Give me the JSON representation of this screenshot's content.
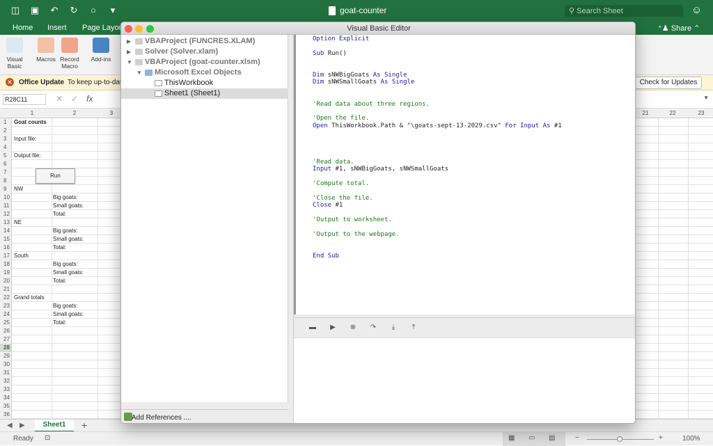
{
  "excel": {
    "doc_title": "goat-counter",
    "search_placeholder": "Search Sheet",
    "tabs": [
      "Home",
      "Insert",
      "Page Layou"
    ],
    "share_label": "Share",
    "ribbon_buttons": [
      {
        "label": "Visual Basic",
        "icon": "visual-basic-icon"
      },
      {
        "label": "Macros",
        "icon": "macros-icon"
      },
      {
        "label": "Record Macro",
        "icon": "record-macro-icon"
      },
      {
        "label": "Add-ins",
        "icon": "add-ins-icon"
      }
    ],
    "update_bar": {
      "title": "Office Update",
      "text": "To keep up-to-dat",
      "button": "Check for Updates"
    },
    "name_box": "R28C11",
    "fx_label": "fx",
    "col_headers_left": [
      "1",
      "2",
      "3"
    ],
    "col_headers_right": [
      "21",
      "22",
      "23"
    ],
    "rows": [
      {
        "n": "1",
        "a": "Goat counts",
        "b": "",
        "bold": true
      },
      {
        "n": "2",
        "a": "",
        "b": ""
      },
      {
        "n": "3",
        "a": "Input file:",
        "b": ""
      },
      {
        "n": "4",
        "a": "",
        "b": ""
      },
      {
        "n": "5",
        "a": "Output file:",
        "b": ""
      },
      {
        "n": "6",
        "a": "",
        "b": ""
      },
      {
        "n": "7",
        "a": "",
        "b": ""
      },
      {
        "n": "8",
        "a": "",
        "b": ""
      },
      {
        "n": "9",
        "a": "NW",
        "b": ""
      },
      {
        "n": "10",
        "a": "",
        "b": "Big goats:"
      },
      {
        "n": "11",
        "a": "",
        "b": "Small goats:"
      },
      {
        "n": "12",
        "a": "",
        "b": "Total:"
      },
      {
        "n": "13",
        "a": "NE",
        "b": ""
      },
      {
        "n": "14",
        "a": "",
        "b": "Big goats:"
      },
      {
        "n": "15",
        "a": "",
        "b": "Small goats:"
      },
      {
        "n": "16",
        "a": "",
        "b": "Total:"
      },
      {
        "n": "17",
        "a": "South",
        "b": ""
      },
      {
        "n": "18",
        "a": "",
        "b": "Big goats:"
      },
      {
        "n": "19",
        "a": "",
        "b": "Small goats:"
      },
      {
        "n": "20",
        "a": "",
        "b": "Total:"
      },
      {
        "n": "21",
        "a": "",
        "b": ""
      },
      {
        "n": "22",
        "a": "Grand totals",
        "b": ""
      },
      {
        "n": "23",
        "a": "",
        "b": "Big goats:"
      },
      {
        "n": "24",
        "a": "",
        "b": "Small goats:"
      },
      {
        "n": "25",
        "a": "",
        "b": "Total:"
      },
      {
        "n": "26",
        "a": "",
        "b": ""
      },
      {
        "n": "27",
        "a": "",
        "b": ""
      },
      {
        "n": "28",
        "a": "",
        "b": "",
        "selected": true
      },
      {
        "n": "29",
        "a": "",
        "b": ""
      },
      {
        "n": "30",
        "a": "",
        "b": ""
      },
      {
        "n": "31",
        "a": "",
        "b": ""
      },
      {
        "n": "32",
        "a": "",
        "b": ""
      },
      {
        "n": "33",
        "a": "",
        "b": ""
      },
      {
        "n": "34",
        "a": "",
        "b": ""
      },
      {
        "n": "35",
        "a": "",
        "b": ""
      },
      {
        "n": "36",
        "a": "",
        "b": ""
      }
    ],
    "run_button": "Run",
    "sheet_tab": "Sheet1",
    "status": "Ready",
    "zoom": "100%"
  },
  "vbe": {
    "title": "Visual Basic Editor",
    "projects": [
      {
        "label": "VBAProject (FUNCRES.XLAM)",
        "level": 0,
        "arrow": "▶",
        "bold": true,
        "dim": true
      },
      {
        "label": "Solver (Solver.xlam)",
        "level": 0,
        "arrow": "▶",
        "bold": true,
        "dim": true
      },
      {
        "label": "VBAProject (goat-counter.xlsm)",
        "level": 0,
        "arrow": "▼",
        "bold": true,
        "dim": true
      },
      {
        "label": "Microsoft Excel Objects",
        "level": 1,
        "arrow": "▼",
        "bold": true,
        "dim": true,
        "folder": true
      },
      {
        "label": "ThisWorkbook",
        "level": 2,
        "arrow": ""
      },
      {
        "label": "Sheet1 (Sheet1)",
        "level": 2,
        "arrow": "",
        "selected": true
      }
    ],
    "add_references": "Add References ....",
    "code_lines": [
      {
        "t": "Option Explicit",
        "c": "kw"
      },
      {
        "t": "",
        "c": ""
      },
      {
        "t": "Sub Run()",
        "c": "mix"
      },
      {
        "t": "",
        "c": ""
      },
      {
        "t": "",
        "c": ""
      },
      {
        "t": "Dim sNWBigGoats As Single",
        "c": "mix"
      },
      {
        "t": "Dim sNWSmallGoats As Single",
        "c": "mix"
      },
      {
        "t": "",
        "c": ""
      },
      {
        "t": "",
        "c": ""
      },
      {
        "t": "'Read data about three regions.",
        "c": "cm"
      },
      {
        "t": "",
        "c": ""
      },
      {
        "t": "'Open the file.",
        "c": "cm"
      },
      {
        "t": "Open ThisWorkbook.Path & \"\\goats-sept-13-2029.csv\" For Input As #1",
        "c": "mix"
      },
      {
        "t": "",
        "c": ""
      },
      {
        "t": "",
        "c": ""
      },
      {
        "t": "",
        "c": ""
      },
      {
        "t": "",
        "c": ""
      },
      {
        "t": "'Read data.",
        "c": "cm"
      },
      {
        "t": "Input #1, sNWBigGoats, sNWSmallGoats",
        "c": "mix"
      },
      {
        "t": "",
        "c": ""
      },
      {
        "t": "'Compute total.",
        "c": "cm"
      },
      {
        "t": "",
        "c": ""
      },
      {
        "t": "'Close the file.",
        "c": "cm"
      },
      {
        "t": "Close #1",
        "c": "mix"
      },
      {
        "t": "",
        "c": ""
      },
      {
        "t": "'Output to worksheet.",
        "c": "cm"
      },
      {
        "t": "",
        "c": ""
      },
      {
        "t": "'Output to the webpage.",
        "c": "cm"
      },
      {
        "t": "",
        "c": ""
      },
      {
        "t": "",
        "c": ""
      },
      {
        "t": "End Sub",
        "c": "mix"
      }
    ],
    "debug_icons": [
      "toggle-breakpoint-icon",
      "run-icon",
      "stop-icon",
      "step-over-icon",
      "step-into-icon",
      "step-out-icon"
    ]
  }
}
